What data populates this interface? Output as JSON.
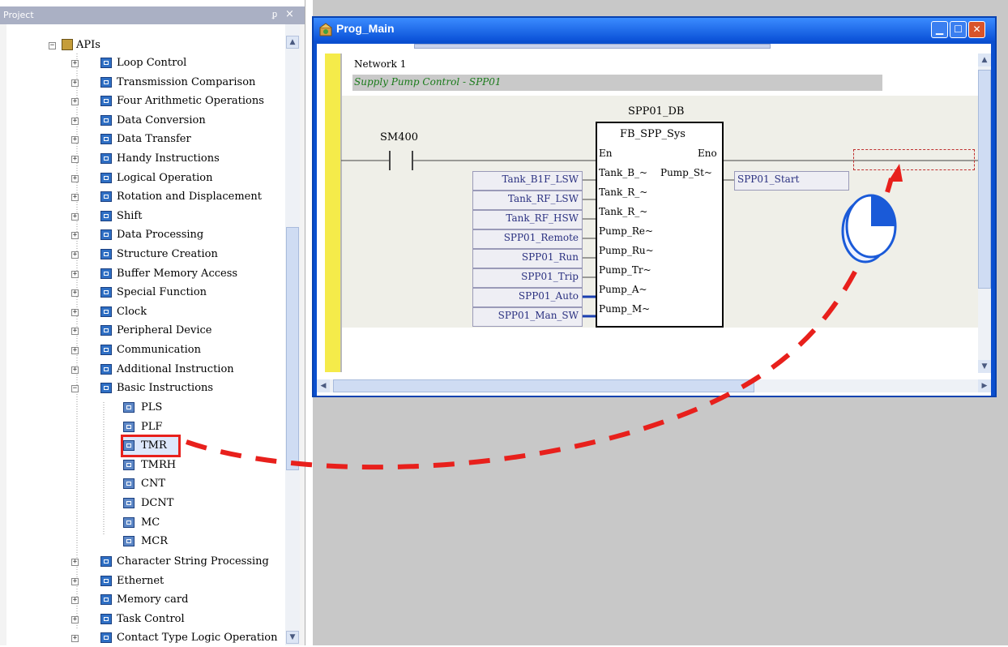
{
  "project_panel": {
    "title": "Project",
    "pin": "ᵱ",
    "close": "×"
  },
  "tree": {
    "root": "APIs",
    "groups": [
      "Loop Control",
      "Transmission Comparison",
      "Four Arithmetic Operations",
      "Data Conversion",
      "Data Transfer",
      "Handy Instructions",
      "Logical Operation",
      "Rotation and Displacement",
      "Shift",
      "Data Processing",
      "Structure Creation",
      "Buffer Memory Access",
      "Special Function",
      "Clock",
      "Peripheral Device",
      "Communication",
      "Additional Instruction",
      "Basic Instructions"
    ],
    "basic_children": [
      "PLS",
      "PLF",
      "TMR",
      "TMRH",
      "CNT",
      "DCNT",
      "MC",
      "MCR"
    ],
    "groups_after": [
      "Character String Processing",
      "Ethernet",
      "Memory card",
      "Task Control",
      "Contact Type Logic Operation"
    ],
    "selected": "TMR"
  },
  "window": {
    "title": "Prog_Main"
  },
  "network": {
    "label": "Network 1",
    "comment": "Supply Pump Control - SPP01"
  },
  "contact": {
    "label": "SM400"
  },
  "fb": {
    "instance": "SPP01_DB",
    "type": "FB_SPP_Sys",
    "en": "En",
    "eno": "Eno",
    "output_pin": "Pump_St~",
    "output_var": "SPP01_Start"
  },
  "inputs": [
    {
      "var": "Tank_B1F_LSW",
      "pin": "Tank_B_~"
    },
    {
      "var": "Tank_RF_LSW",
      "pin": "Tank_R_~"
    },
    {
      "var": "Tank_RF_HSW",
      "pin": "Tank_R_~"
    },
    {
      "var": "SPP01_Remote",
      "pin": "Pump_Re~"
    },
    {
      "var": "SPP01_Run",
      "pin": "Pump_Ru~"
    },
    {
      "var": "SPP01_Trip",
      "pin": "Pump_Tr~"
    },
    {
      "var": "SPP01_Auto",
      "pin": "Pump_A~"
    },
    {
      "var": "SPP01_Man_SW",
      "pin": "Pump_M~"
    }
  ],
  "colors": {
    "accent": "#e8201c",
    "title_bar": "#0b52d8",
    "rail": "#f5eb4a"
  }
}
